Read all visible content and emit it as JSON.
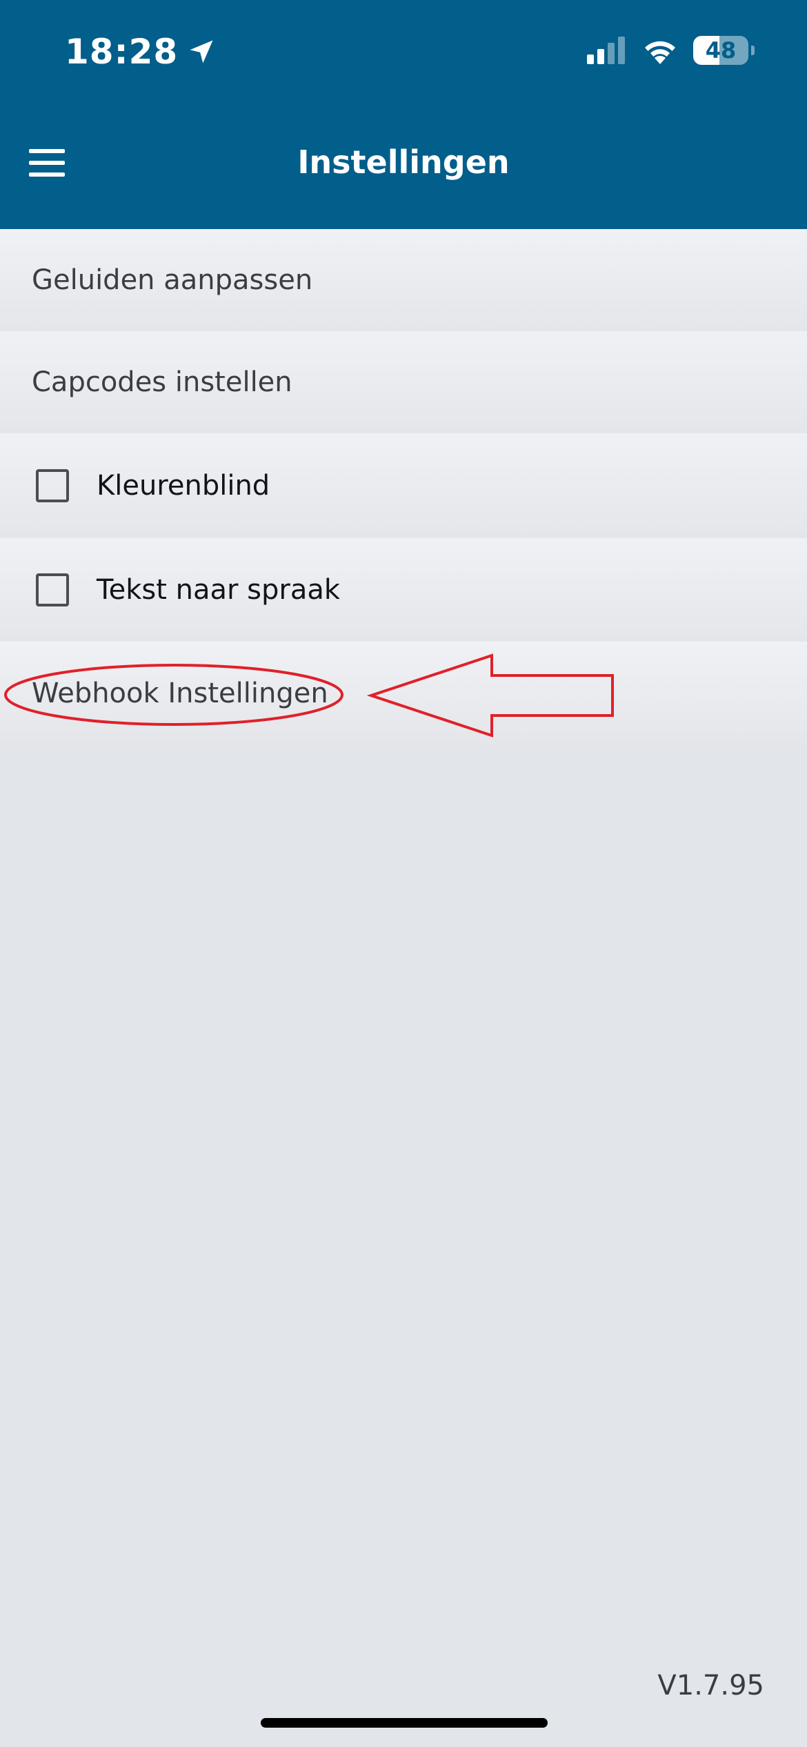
{
  "status_bar": {
    "time": "18:28",
    "battery": "48",
    "battery_level": 0.48
  },
  "header": {
    "title": "Instellingen"
  },
  "settings": [
    {
      "type": "link",
      "label": "Geluiden aanpassen"
    },
    {
      "type": "link",
      "label": "Capcodes instellen"
    },
    {
      "type": "checkbox",
      "label": "Kleurenblind",
      "checked": false
    },
    {
      "type": "checkbox",
      "label": "Tekst naar spraak",
      "checked": false
    },
    {
      "type": "link",
      "label": "Webhook Instellingen"
    }
  ],
  "footer": {
    "version": "V1.7.95"
  },
  "colors": {
    "header_bg": "#025e8b",
    "page_bg": "#e2e5ea",
    "annotation": "#e0202a"
  },
  "icons": [
    "location-arrow-icon",
    "cellular-signal-icon",
    "wifi-icon",
    "battery-icon",
    "hamburger-menu-icon"
  ]
}
